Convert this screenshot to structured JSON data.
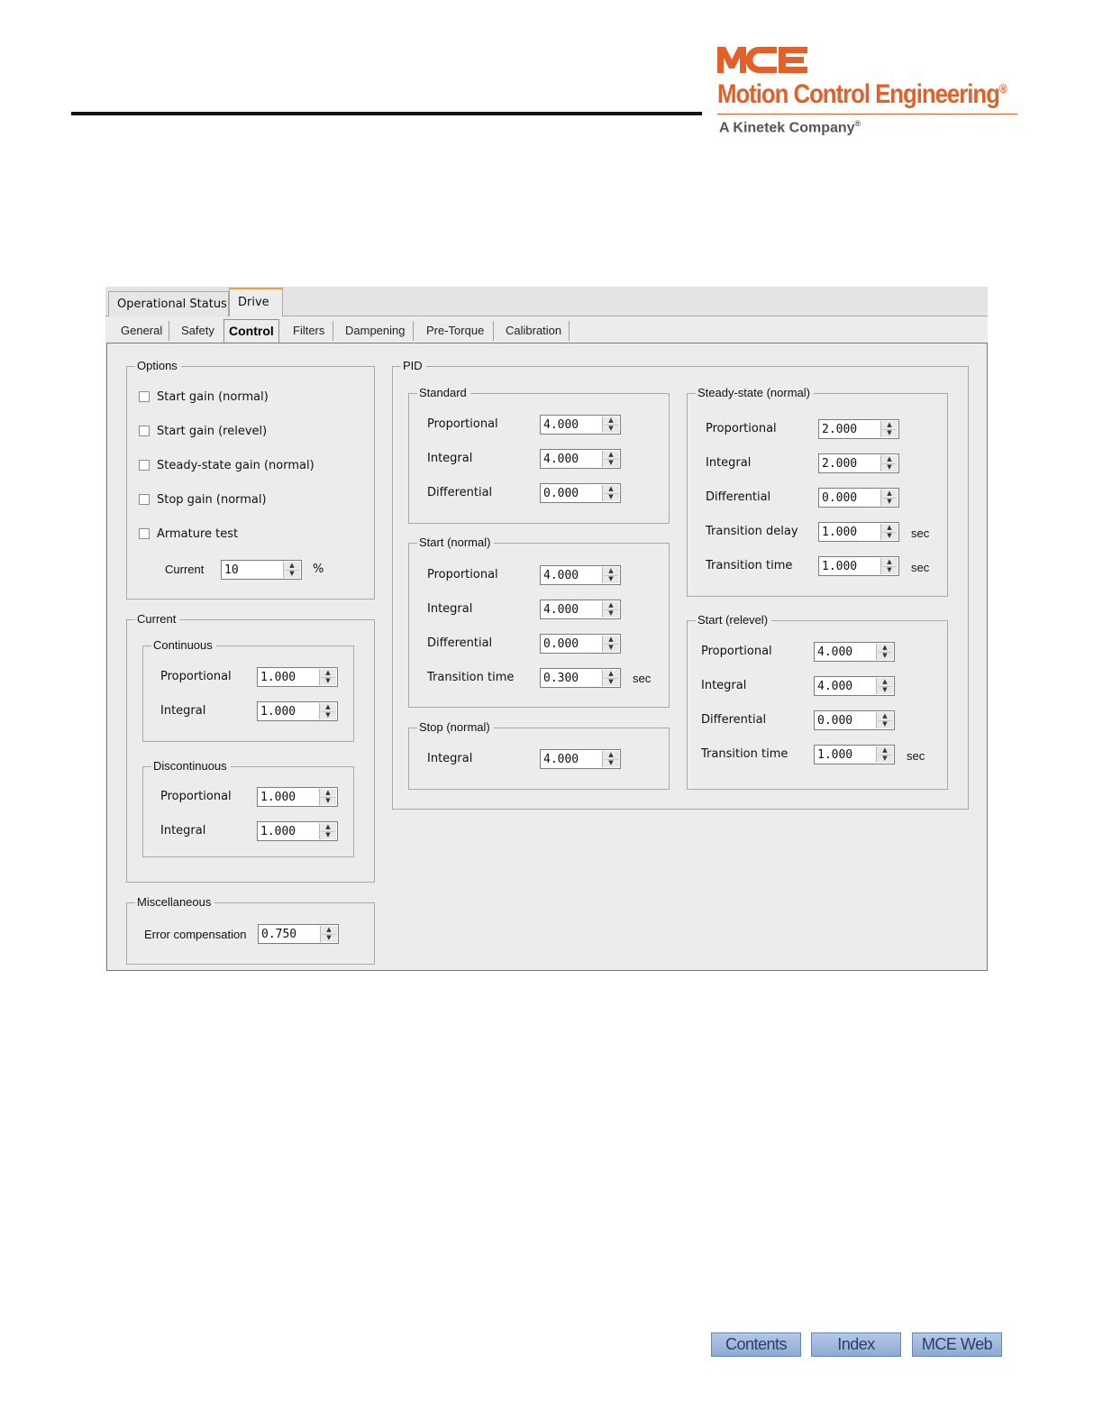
{
  "brand": {
    "mark": "MCE",
    "name": "Motion Control Engineering",
    "reg": "®",
    "tagline": "A Kinetek Company",
    "tagline_reg": "®",
    "color": "#e0622a"
  },
  "top_tabs": [
    "Operational Status",
    "Drive"
  ],
  "sub_tabs": [
    "General",
    "Safety",
    "Control",
    "Filters",
    "Dampening",
    "Pre-Torque",
    "Calibration"
  ],
  "active_sub_tab": "Control",
  "options": {
    "title": "Options",
    "checkboxes": [
      "Start gain (normal)",
      "Start gain (relevel)",
      "Steady-state gain (normal)",
      "Stop gain (normal)",
      "Armature test"
    ],
    "current_label": "Current",
    "current_value": "10",
    "current_unit": "%"
  },
  "current": {
    "title": "Current",
    "continuous": {
      "title": "Continuous",
      "proportional_label": "Proportional",
      "proportional": "1.000",
      "integral_label": "Integral",
      "integral": "1.000"
    },
    "discontinuous": {
      "title": "Discontinuous",
      "proportional_label": "Proportional",
      "proportional": "1.000",
      "integral_label": "Integral",
      "integral": "1.000"
    }
  },
  "misc": {
    "title": "Miscellaneous",
    "error_comp_label": "Error compensation",
    "error_comp": "0.750"
  },
  "pid": {
    "title": "PID",
    "standard": {
      "title": "Standard",
      "proportional_label": "Proportional",
      "proportional": "4.000",
      "integral_label": "Integral",
      "integral": "4.000",
      "differential_label": "Differential",
      "differential": "0.000"
    },
    "start_normal": {
      "title": "Start (normal)",
      "proportional_label": "Proportional",
      "proportional": "4.000",
      "integral_label": "Integral",
      "integral": "4.000",
      "differential_label": "Differential",
      "differential": "0.000",
      "transition_time_label": "Transition time",
      "transition_time": "0.300",
      "unit": "sec"
    },
    "stop_normal": {
      "title": "Stop (normal)",
      "integral_label": "Integral",
      "integral": "4.000"
    },
    "steady_state": {
      "title": "Steady-state (normal)",
      "proportional_label": "Proportional",
      "proportional": "2.000",
      "integral_label": "Integral",
      "integral": "2.000",
      "differential_label": "Differential",
      "differential": "0.000",
      "transition_delay_label": "Transition delay",
      "transition_delay": "1.000",
      "transition_time_label": "Transition time",
      "transition_time": "1.000",
      "unit": "sec"
    },
    "start_relevel": {
      "title": "Start (relevel)",
      "proportional_label": "Proportional",
      "proportional": "4.000",
      "integral_label": "Integral",
      "integral": "4.000",
      "differential_label": "Differential",
      "differential": "0.000",
      "transition_time_label": "Transition time",
      "transition_time": "1.000",
      "unit": "sec"
    }
  },
  "nav": [
    "Contents",
    "Index",
    "MCE Web"
  ]
}
